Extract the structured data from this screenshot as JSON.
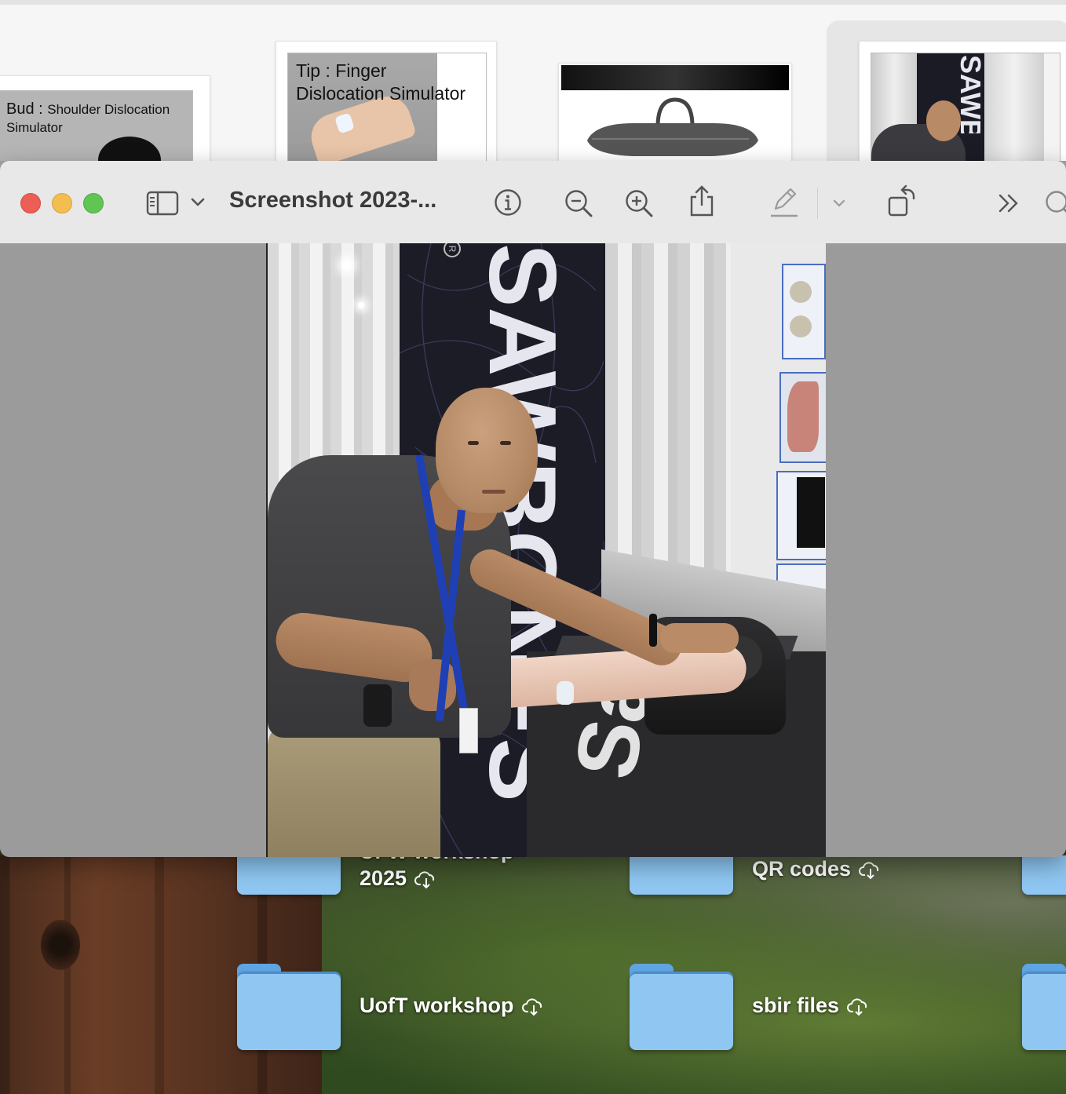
{
  "finder_window": {
    "thumbnails": [
      {
        "line1_lead": "Bud",
        "line1_sep": " : ",
        "line1_rest": "Shoulder Dislocation",
        "line2": "Simulator"
      },
      {
        "line1": "Tip : Finger",
        "line2": "Dislocation Simulator"
      }
    ],
    "banner_lettering": "SAWBONES"
  },
  "preview_window": {
    "title": "Screenshot 2023-...",
    "toolbar": {
      "sidebar_toggle": "sidebar-icon",
      "sidebar_menu": "chevron-down-icon",
      "info": "info-icon",
      "zoom_out": "zoom-out-icon",
      "zoom_in": "zoom-in-icon",
      "share": "share-icon",
      "markup": "pencil-icon",
      "markup_menu": "chevron-down-icon",
      "rotate": "rotate-icon",
      "more": "more-icon",
      "search": "search-icon"
    },
    "photo": {
      "banner_lettering": "SAWBONES",
      "trademark": "R",
      "table_lettering": "Sa"
    }
  },
  "desktop": {
    "folders": [
      {
        "name_partial": "UFW workshop",
        "name_line2": "2025",
        "status": "cloud-download-icon"
      },
      {
        "name": "QR codes",
        "status": "cloud-download-icon"
      },
      {
        "name": "UofT workshop",
        "status": "cloud-download-icon"
      },
      {
        "name": "sbir files",
        "status": "cloud-download-icon"
      }
    ]
  },
  "colors": {
    "close": "#ec5f57",
    "minimize": "#f3bd4f",
    "zoom": "#61c554",
    "folder": "#8fc7f2",
    "toolbar_bg": "#e8e8e8",
    "content_bg": "#9b9b9b"
  }
}
